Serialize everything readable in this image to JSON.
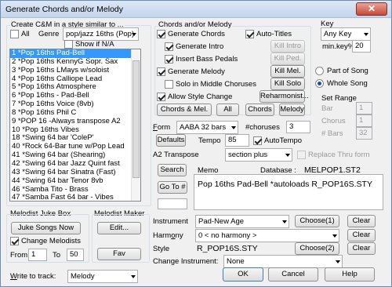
{
  "window": {
    "title": "Generate Chords and/or Melody",
    "close": "✕"
  },
  "style": {
    "group_label": "Create C&M in a style similar to ...",
    "all_label": "All",
    "genre_label": "Genre",
    "genre_value": "pop/jazz 16ths (Pop)",
    "show_na_label": "Show if N/A",
    "items": [
      "1 *Pop 16ths Pad-Bell",
      "2 *Pop 16ths KennyG Sopr. Sax",
      "3 *Pop 16ths LMays w/soloist",
      "4 *Pop 16ths Calliope Lead",
      "5 *Pop 16ths Atmosphere",
      "6 *Pop 16ths - Pad-Bell",
      "7 *Pop 16ths Voice (8vb)",
      "8 *Pop 16ths Phil C",
      "9 *POP 16 -Always transpose A2",
      "10 *Pop 16ths Vibes",
      "18 *Swing 64 bar 'ColeP'",
      "40 *Rock 64-Bar tune w/Pop Lead",
      "41 *Swing 64 bar (Shearing)",
      "42 *Swing 64 bar Jazz Quint fast",
      "43 *Swing 64 bar Sinatra (Fast)",
      "44 *Swing 64 bar Tenor 8vb",
      "46 *Samba Tito - Brass",
      "47 *Samba Fast 64 bar - Vibes"
    ]
  },
  "chords_melody": {
    "group_label": "Chords and/or Melody",
    "generate_chords": "Generate Chords",
    "auto_titles": "Auto-Titles",
    "generate_intro": "Generate Intro",
    "kill_intro": "Kill Intro",
    "insert_bass_pedals": "Insert Bass Pedals",
    "kill_ped": "Kill Ped.",
    "generate_melody": "Generate Melody",
    "kill_mel": "Kill Mel.",
    "solo_middle": "Solo in Middle Choruses",
    "kill_solo": "Kill Solo",
    "allow_style_change": "Allow Style Change",
    "reharmonist": "Reharmonist...",
    "btn_chords_mel": "Chords & Mel.",
    "btn_all": "All",
    "btn_chords": "Chords",
    "btn_melody": "Melody"
  },
  "key": {
    "group_label": "Key",
    "value": "Any Key",
    "min_key_label": "min.key%",
    "min_key_value": "20",
    "part_of_song": "Part of Song",
    "whole_song": "Whole Song"
  },
  "set_range": {
    "group_label": "Set Range",
    "bar_label": "Bar",
    "bar_value": "1",
    "chorus_label": "Chorus",
    "chorus_value": "1",
    "bars_label": "# Bars",
    "bars_value": "32"
  },
  "form": {
    "label": "Form",
    "value": "AABA 32 bars",
    "choruses_label": "#choruses",
    "choruses_value": "3",
    "defaults": "Defaults",
    "tempo_label": "Tempo",
    "tempo_value": "85",
    "autotempo": "AutoTempo",
    "a2_label": "A2 Transpose",
    "a2_value": "section plus",
    "replace_label": "Replace Thru form"
  },
  "search": {
    "button": "Search",
    "memo_label": "Memo",
    "database_label": "Database :",
    "database_value": "MELPOP1.ST2",
    "goto": "Go To #",
    "memo_text": "Pop 16ths Pad-Bell   *autoloads R_POP16S.STY",
    "goto_value": ""
  },
  "instrument": {
    "label": "Instrument",
    "value": "Pad-New Age",
    "choose1": "Choose(1)",
    "clear1": "Clear",
    "harmony_label": "Harmony",
    "harmony_value": "0 < no harmony >",
    "clear2": "Clear",
    "style_label": "Style",
    "style_value": "R_POP16S.STY",
    "choose2": "Choose(2)",
    "clear3": "Clear",
    "change_label": "Change Instrument:",
    "change_value": "None"
  },
  "jukebox": {
    "group_label": "Melodist Juke Box",
    "button": "Juke Songs Now",
    "change_melodists": "Change Melodists",
    "from_label": "From",
    "from_value": "1",
    "to_label": "To",
    "to_value": "50"
  },
  "maker": {
    "group_label": "Melodist Maker",
    "edit": "Edit...",
    "fav": "Fav"
  },
  "write": {
    "label": "Write to track:",
    "value": "Melody"
  },
  "footer": {
    "ok": "OK",
    "cancel": "Cancel",
    "help": "Help"
  }
}
